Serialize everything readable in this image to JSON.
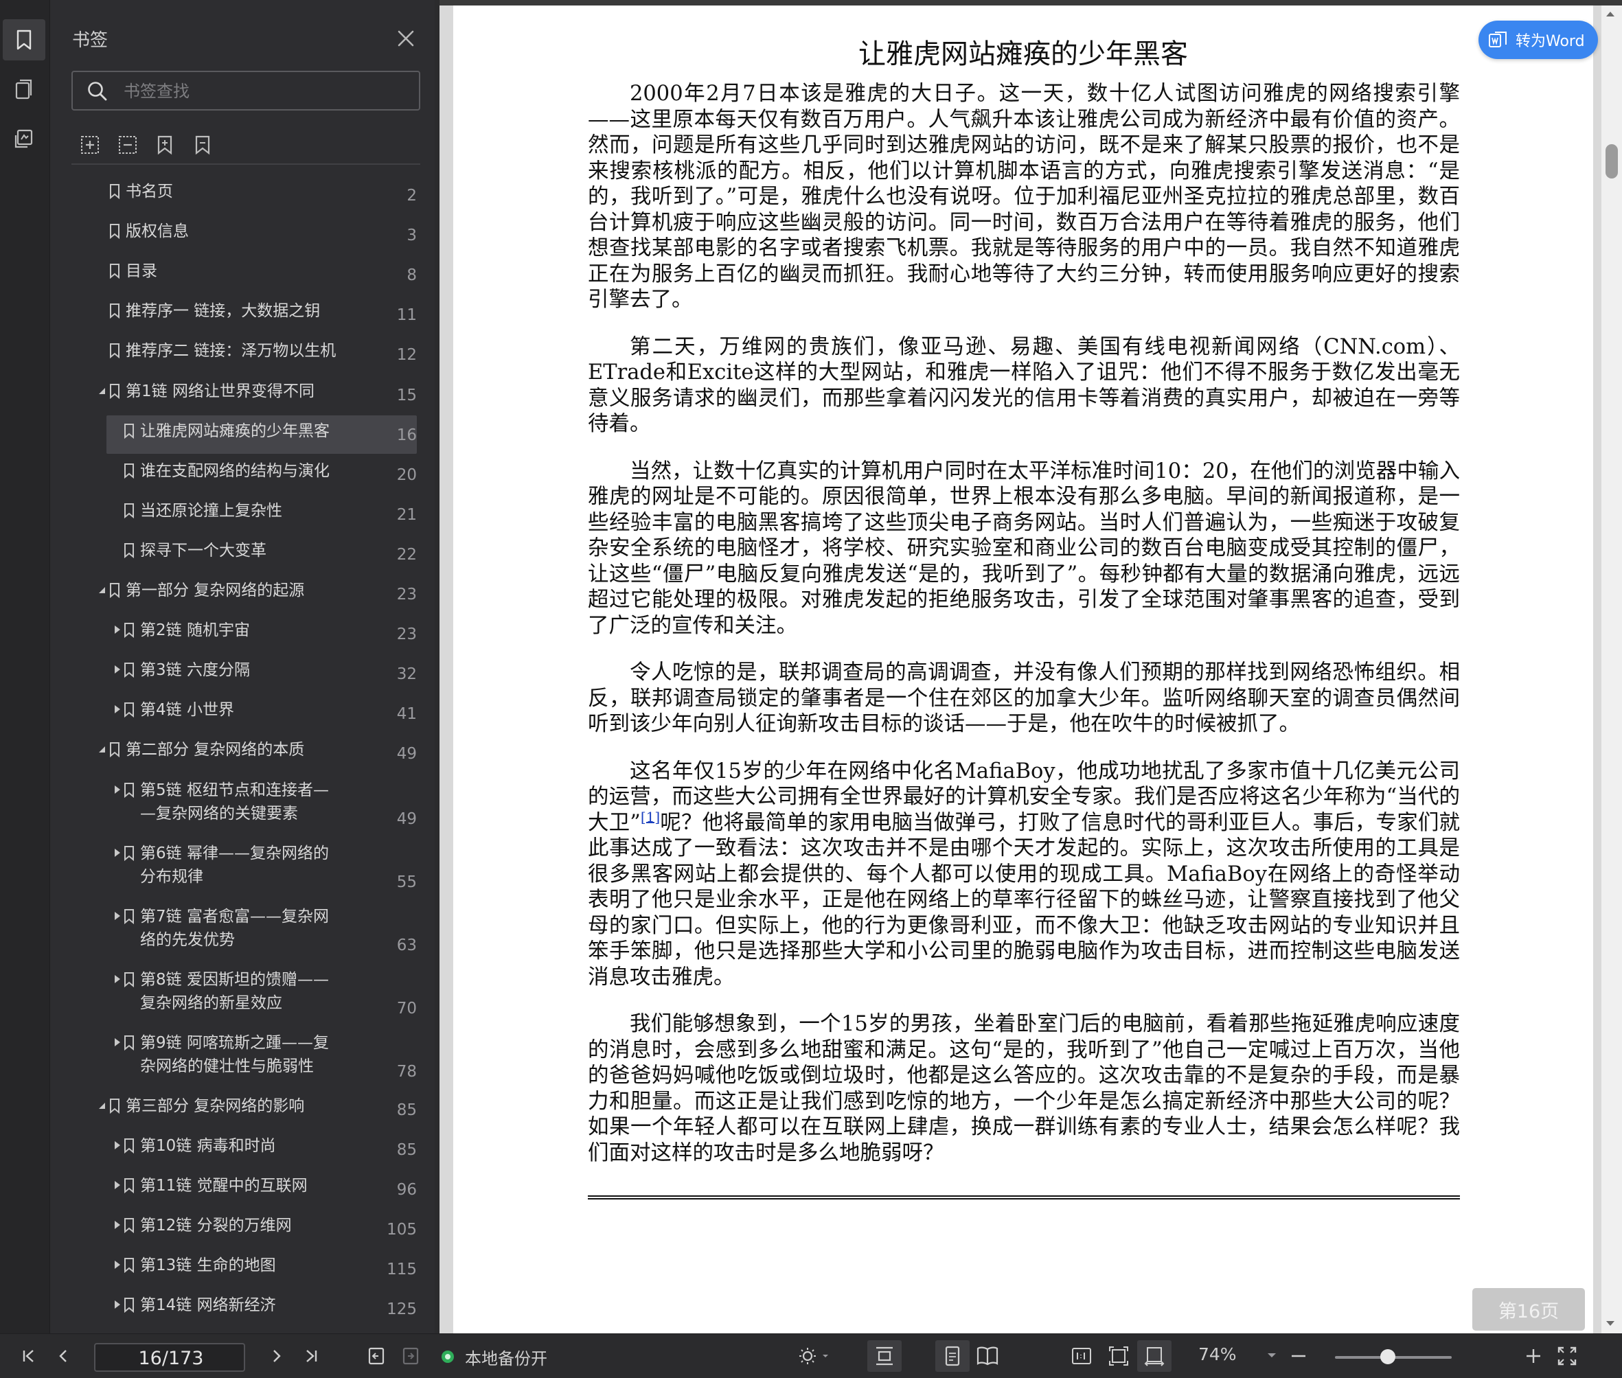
{
  "sidebar": {
    "title": "书签",
    "search_placeholder": "书签查找",
    "tools": [
      "expand-all-icon",
      "collapse-all-icon",
      "add-bookmark-icon",
      "remove-bookmark-icon"
    ],
    "items": [
      {
        "label": "书名页",
        "page": "2",
        "level": 0,
        "expander": "none"
      },
      {
        "label": "版权信息",
        "page": "3",
        "level": 0,
        "expander": "none"
      },
      {
        "label": "目录",
        "page": "8",
        "level": 0,
        "expander": "none"
      },
      {
        "label": "推荐序一 链接，大数据之钥",
        "page": "11",
        "level": 0,
        "expander": "none"
      },
      {
        "label": "推荐序二 链接：泽万物以生机",
        "page": "12",
        "level": 0,
        "expander": "none"
      },
      {
        "label": "第1链 网络让世界变得不同",
        "page": "15",
        "level": 0,
        "expander": "expanded"
      },
      {
        "label": "让雅虎网站瘫痪的少年黑客",
        "page": "16",
        "level": 1,
        "expander": "none",
        "selected": true
      },
      {
        "label": "谁在支配网络的结构与演化",
        "page": "20",
        "level": 1,
        "expander": "none"
      },
      {
        "label": "当还原论撞上复杂性",
        "page": "21",
        "level": 1,
        "expander": "none"
      },
      {
        "label": "探寻下一个大变革",
        "page": "22",
        "level": 1,
        "expander": "none"
      },
      {
        "label": "第一部分 复杂网络的起源",
        "page": "23",
        "level": 0,
        "expander": "expanded"
      },
      {
        "label": "第2链 随机宇宙",
        "page": "23",
        "level": 1,
        "expander": "collapsed"
      },
      {
        "label": "第3链 六度分隔",
        "page": "32",
        "level": 1,
        "expander": "collapsed"
      },
      {
        "label": "第4链 小世界",
        "page": "41",
        "level": 1,
        "expander": "collapsed"
      },
      {
        "label": "第二部分 复杂网络的本质",
        "page": "49",
        "level": 0,
        "expander": "expanded"
      },
      {
        "label": "第5链 枢纽节点和连接者—\n—复杂网络的关键要素",
        "page": "49",
        "level": 1,
        "expander": "collapsed"
      },
      {
        "label": "第6链 幂律——复杂网络的\n分布规律",
        "page": "55",
        "level": 1,
        "expander": "collapsed"
      },
      {
        "label": "第7链 富者愈富——复杂网\n络的先发优势",
        "page": "63",
        "level": 1,
        "expander": "collapsed"
      },
      {
        "label": "第8链 爱因斯坦的馈赠——\n复杂网络的新星效应",
        "page": "70",
        "level": 1,
        "expander": "collapsed"
      },
      {
        "label": "第9链 阿喀琉斯之踵——复\n杂网络的健壮性与脆弱性",
        "page": "78",
        "level": 1,
        "expander": "collapsed"
      },
      {
        "label": "第三部分 复杂网络的影响",
        "page": "85",
        "level": 0,
        "expander": "expanded"
      },
      {
        "label": "第10链 病毒和时尚",
        "page": "85",
        "level": 1,
        "expander": "collapsed"
      },
      {
        "label": "第11链 觉醒中的互联网",
        "page": "96",
        "level": 1,
        "expander": "collapsed"
      },
      {
        "label": "第12链 分裂的万维网",
        "page": "105",
        "level": 1,
        "expander": "collapsed"
      },
      {
        "label": "第13链 生命的地图",
        "page": "115",
        "level": 1,
        "expander": "collapsed"
      },
      {
        "label": "第14链 网络新经济",
        "page": "125",
        "level": 1,
        "expander": "collapsed"
      }
    ]
  },
  "document": {
    "title": "让雅虎网站瘫痪的少年黑客",
    "paragraphs": [
      {
        "text": "2000年2月7日本该是雅虎的大日子。这一天，数十亿人试图访问雅虎的网络搜索引擎——这里原本每天仅有数百万用户。人气飙升本该让雅虎公司成为新经济中最有价值的资产。然而，问题是所有这些几乎同时到达雅虎网站的访问，既不是来了解某只股票的报价，也不是来搜索核桃派的配方。相反，他们以计算机脚本语言的方式，向雅虎搜索引擎发送消息：“是的，我听到了。”可是，雅虎什么也没有说呀。位于加利福尼亚州圣克拉拉的雅虎总部里，数百台计算机疲于响应这些幽灵般的访问。同一时间，数百万合法用户在等待着雅虎的服务，他们想查找某部电影的名字或者搜索飞机票。我就是等待服务的用户中的一员。我自然不知道雅虎正在为服务上百亿的幽灵而抓狂。我耐心地等待了大约三分钟，转而使用服务响应更好的搜索引擎去了。"
      },
      {
        "text": "第二天，万维网的贵族们，像亚马逊、易趣、美国有线电视新闻网络（CNN.com）、ETrade和Excite这样的大型网站，和雅虎一样陷入了诅咒：他们不得不服务于数亿发出毫无意义服务请求的幽灵们，而那些拿着闪闪发光的信用卡等着消费的真实用户，却被迫在一旁等待着。"
      },
      {
        "text": "当然，让数十亿真实的计算机用户同时在太平洋标准时间10：20，在他们的浏览器中输入雅虎的网址是不可能的。原因很简单，世界上根本没有那么多电脑。早间的新闻报道称，是一些经验丰富的电脑黑客搞垮了这些顶尖电子商务网站。当时人们普遍认为，一些痴迷于攻破复杂安全系统的电脑怪才，将学校、研究实验室和商业公司的数百台电脑变成受其控制的僵尸，让这些“僵尸”电脑反复向雅虎发送“是的，我听到了”。每秒钟都有大量的数据涌向雅虎，远远超过它能处理的极限。对雅虎发起的拒绝服务攻击，引发了全球范围对肇事黑客的追查，受到了广泛的宣传和关注。"
      },
      {
        "text": "令人吃惊的是，联邦调查局的高调调查，并没有像人们预期的那样找到网络恐怖组织。相反，联邦调查局锁定的肇事者是一个住在郊区的加拿大少年。监听网络聊天室的调查员偶然间听到该少年向别人征询新攻击目标的谈话——于是，他在吹牛的时候被抓了。"
      },
      {
        "text_before": "这名年仅15岁的少年在网络中化名MafiaBoy，他成功地扰乱了多家市值十几亿美元公司的运营，而这些大公司拥有全世界最好的计算机安全专家。我们是否应将这名少年称为“当代的大卫”",
        "footnote": "[1]",
        "text_after": "呢？他将最简单的家用电脑当做弹弓，打败了信息时代的哥利亚巨人。事后，专家们就此事达成了一致看法：这次攻击并不是由哪个天才发起的。实际上，这次攻击所使用的工具是很多黑客网站上都会提供的、每个人都可以使用的现成工具。MafiaBoy在网络上的奇怪举动表明了他只是业余水平，正是他在网络上的草率行径留下的蛛丝马迹，让警察直接找到了他父母的家门口。但实际上，他的行为更像哥利亚，而不像大卫：他缺乏攻击网站的专业知识并且笨手笨脚，他只是选择那些大学和小公司里的脆弱电脑作为攻击目标，进而控制这些电脑发送消息攻击雅虎。"
      },
      {
        "text": "我们能够想象到，一个15岁的男孩，坐着卧室门后的电脑前，看着那些拖延雅虎响应速度的消息时，会感到多么地甜蜜和满足。这句“是的，我听到了”他自己一定喊过上百万次，当他的爸爸妈妈喊他吃饭或倒垃圾时，他都是这么答应的。这次攻击靠的不是复杂的手段，而是暴力和胆量。而这正是让我们感到吃惊的地方，一个少年是怎么搞定新经济中那些大公司的呢？如果一个年轻人都可以在互联网上肆虐，换成一群训练有素的专业人士，结果会怎么样呢？我们面对这样的攻击时是多么地脆弱呀？"
      }
    ],
    "convert_button": "转为Word",
    "page_badge": "第16页"
  },
  "statusbar": {
    "page_input": "16/173",
    "backup_label": "本地备份开",
    "zoom": "74%",
    "zoom_level": 0.45
  }
}
